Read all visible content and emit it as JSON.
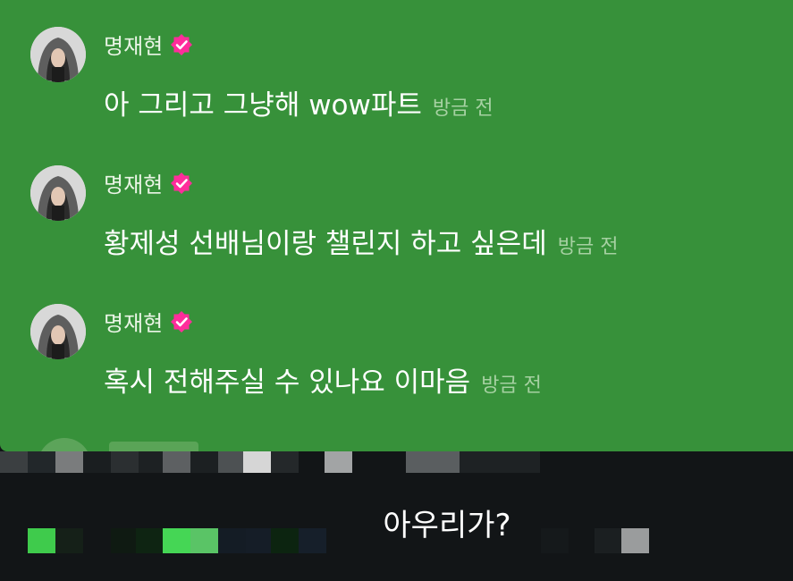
{
  "colors": {
    "chat_background": "#37913a",
    "bottom_background": "#121517",
    "name_text": "#eaf5e6",
    "message_text": "#ffffff",
    "timestamp_text": "#a6d1a2",
    "verified_badge": "#ff2d9b"
  },
  "messages": [
    {
      "username": "명재현",
      "verified": true,
      "text": "아 그리고 그냥해 wow파트",
      "time": "방금 전"
    },
    {
      "username": "명재현",
      "verified": true,
      "text": "황제성 선배님이랑 챌린지 하고 싶은데",
      "time": "방금 전"
    },
    {
      "username": "명재현",
      "verified": true,
      "text": "혹시 전해주실 수 있나요 이마음",
      "time": "방금 전"
    }
  ],
  "icons": {
    "verified": "verified-badge-icon",
    "avatar": "profile-avatar"
  },
  "caption": {
    "text": "아우리가?"
  }
}
